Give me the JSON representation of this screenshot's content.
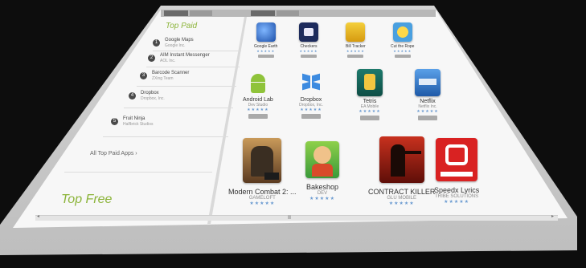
{
  "sidebar": {
    "heading": "Top Paid",
    "items": [
      {
        "num": "1",
        "title": "Google Maps",
        "sub": "Google Inc."
      },
      {
        "num": "2",
        "title": "AIM Instant Messenger",
        "sub": "AOL Inc."
      },
      {
        "num": "3",
        "title": "Barcode Scanner",
        "sub": "ZXing Team"
      },
      {
        "num": "4",
        "title": "Dropbox",
        "sub": "Dropbox, Inc."
      },
      {
        "num": "5",
        "title": "Fruit Ninja",
        "sub": "Halfbrick Studios"
      }
    ],
    "more": "All Top Paid Apps ›",
    "section2": "Top Free"
  },
  "apps_row1": [
    {
      "name": "Google Earth",
      "dev": "Google Inc.",
      "stars": "★★★★★"
    },
    {
      "name": "Checkers",
      "dev": "Aart Bik",
      "stars": "★★★★★"
    },
    {
      "name": "Bill Tracker",
      "dev": "Dev Inc.",
      "stars": "★★★★★"
    },
    {
      "name": "Cut the Rope",
      "dev": "ZeptoLab",
      "stars": "★★★★★"
    }
  ],
  "apps_row2": [
    {
      "name": "Android Lab",
      "dev": "Dev Studio",
      "stars": "★★★★★"
    },
    {
      "name": "Dropbox",
      "dev": "Dropbox, Inc.",
      "stars": "★★★★★"
    },
    {
      "name": "Tetris",
      "dev": "EA Mobile",
      "stars": "★★★★★"
    },
    {
      "name": "Netflix",
      "dev": "Netflix Inc.",
      "stars": "★★★★★"
    }
  ],
  "apps_row3": [
    {
      "name": "Modern Combat 2: ...",
      "dev": "GAMELOFT",
      "stars": "★★★★★"
    },
    {
      "name": "Bakeshop",
      "dev": "DEV",
      "stars": "★★★★★"
    },
    {
      "name": "CONTRACT KILLER",
      "dev": "GLU MOBILE",
      "stars": "★★★★★"
    },
    {
      "name": "Speedx Lyrics",
      "dev": "TRIBE SOLUTIONS",
      "stars": "★★★★★"
    }
  ],
  "button_label": "",
  "colors": {
    "accent_green": "#8cb43a",
    "star_blue": "#6b9bd1",
    "background": "#0d0d0d"
  }
}
